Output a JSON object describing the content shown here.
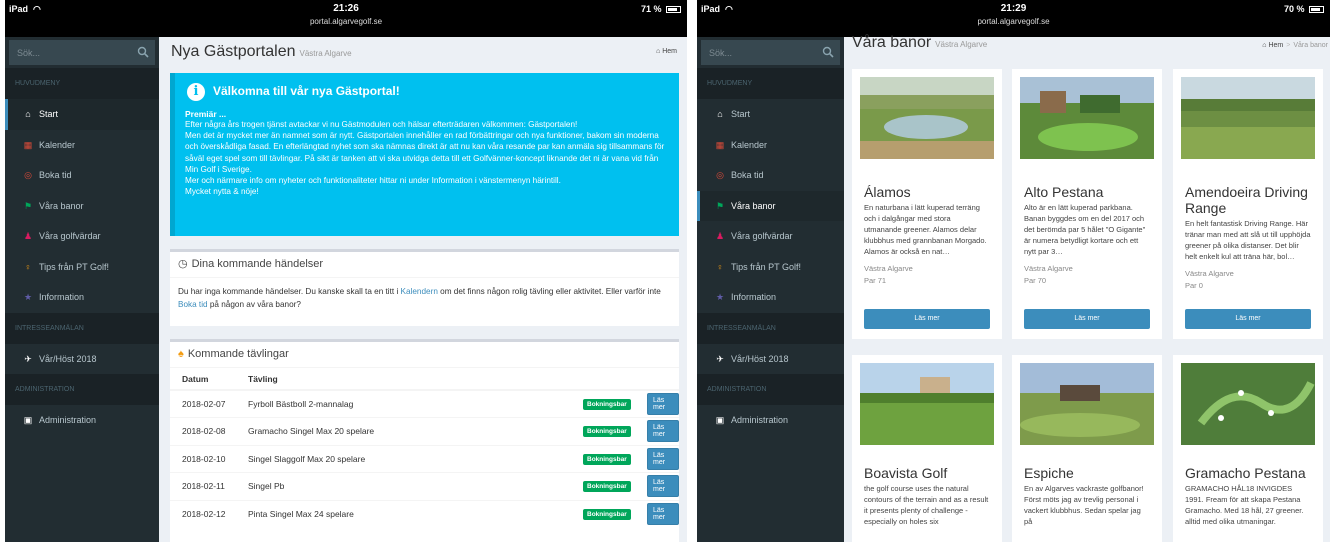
{
  "left": {
    "status": {
      "device": "iPad",
      "time": "21:26",
      "url": "portal.algarvegolf.se",
      "battery": "71 %",
      "battery_level": 0.71
    },
    "sidebar": {
      "search_placeholder": "Sök...",
      "header_main": "HUVUDMENY",
      "items": [
        {
          "label": "Start"
        },
        {
          "label": "Kalender"
        },
        {
          "label": "Boka tid"
        },
        {
          "label": "Våra banor"
        },
        {
          "label": "Våra golfvärdar"
        },
        {
          "label": "Tips från PT Golf!"
        },
        {
          "label": "Information"
        }
      ],
      "header_interest": "INTRESSEANMÄLAN",
      "interest_item": "Vår/Höst 2018",
      "header_admin": "ADMINISTRATION",
      "admin_item": "Administration"
    },
    "page": {
      "title": "Nya Gästportalen",
      "subtitle": "Västra Algarve",
      "breadcrumb": "Hem"
    },
    "callout": {
      "title": "Välkomna till vår nya Gästportal!",
      "subtitle": "Premiär ...",
      "paragraphs": [
        "Efter några års trogen tjänst avtackar vi nu Gästmodulen och hälsar efterträdaren välkommen: Gästportalen!",
        "Men det är mycket mer än namnet som är nytt. Gästportalen innehåller en rad förbättringar och nya funktioner, bakom sin moderna och överskådliga fasad. En efterlängtad nyhet som ska nämnas direkt är att nu kan våra resande par kan anmäla sig tillsammans för såväl eget spel som till tävlingar. På sikt är tanken att vi ska utvidga detta till ett Golfvänner-koncept liknande det ni är vana vid från Min Golf i Sverige.",
        "Mer och närmare info om nyheter och funktionaliteter hittar ni under Information i vänstermenyn härintill.",
        "Mycket nytta & nöje!"
      ]
    },
    "events": {
      "title": "Dina kommande händelser",
      "text_before_link1": "Du har inga kommande händelser. Du kanske skall ta en titt i ",
      "link1": "Kalendern",
      "text_mid": " om det finns någon rolig tävling eller aktivitet. Eller varför inte ",
      "link2": "Boka tid",
      "text_after": " på någon av våra banor?"
    },
    "competitions": {
      "title": "Kommande tävlingar",
      "col_date": "Datum",
      "col_comp": "Tävling",
      "badge": "Bokningsbar",
      "button": "Läs mer",
      "rows": [
        {
          "date": "2018-02-07",
          "name": "Fyrboll Bästboll 2-mannalag"
        },
        {
          "date": "2018-02-08",
          "name": "Gramacho Singel Max 20 spelare"
        },
        {
          "date": "2018-02-10",
          "name": "Singel Slaggolf Max 20 spelare"
        },
        {
          "date": "2018-02-11",
          "name": "Singel Pb"
        },
        {
          "date": "2018-02-12",
          "name": "Pinta Singel Max 24 spelare"
        }
      ]
    }
  },
  "right": {
    "status": {
      "device": "iPad",
      "time": "21:29",
      "url": "portal.algarvegolf.se",
      "battery": "70 %",
      "battery_level": 0.7
    },
    "sidebar": {
      "search_placeholder": "Sök...",
      "header_main": "HUVUDMENY",
      "items": [
        {
          "label": "Start"
        },
        {
          "label": "Kalender"
        },
        {
          "label": "Boka tid"
        },
        {
          "label": "Våra banor"
        },
        {
          "label": "Våra golfvärdar"
        },
        {
          "label": "Tips från PT Golf!"
        },
        {
          "label": "Information"
        }
      ],
      "header_interest": "INTRESSEANMÄLAN",
      "interest_item": "Vår/Höst 2018",
      "header_admin": "ADMINISTRATION",
      "admin_item": "Administration"
    },
    "page": {
      "title": "Våra banor",
      "subtitle": "Västra Algarve",
      "breadcrumb_home": "Hem",
      "breadcrumb_current": "Våra banor"
    },
    "button_label": "Läs mer",
    "courses": [
      {
        "name": "Álamos",
        "desc": "En naturbana i lätt kuperad terräng och i dalgångar med stora utmanande greener. Alamos delar klubbhus med grannbanan Morgado. Alamos är också en nat…",
        "region": "Västra Algarve",
        "par": "Par 71"
      },
      {
        "name": "Alto Pestana",
        "desc": "Alto är en lätt kuperad parkbana. Banan byggdes om en del 2017 och det berömda par 5 hålet \"O Gigante\" är numera betydligt kortare och ett nytt par 3…",
        "region": "Västra Algarve",
        "par": "Par 70"
      },
      {
        "name": "Amendoeira Driving Range",
        "desc": "En helt fantastisk Driving Range. Här tränar man med att slå ut till upphöjda greener på olika distanser. Det blir helt enkelt kul att träna här, bol…",
        "region": "Västra Algarve",
        "par": "Par 0"
      },
      {
        "name": "Boavista Golf",
        "desc": "the golf course uses the natural contours of the terrain and as a result it presents plenty of challenge - especially on holes six"
      },
      {
        "name": "Espiche",
        "desc": "En av Algarves vackraste golfbanor! Först möts jag av trevlig personal i vackert klubbhus. Sedan spelar jag på"
      },
      {
        "name": "Gramacho Pestana",
        "desc": "GRAMACHO HÅL18 INVIGDES 1991. Fream för att skapa Pestana Gramacho. Med 18 hål, 27 greener. alltid med olika utmaningar."
      }
    ]
  }
}
